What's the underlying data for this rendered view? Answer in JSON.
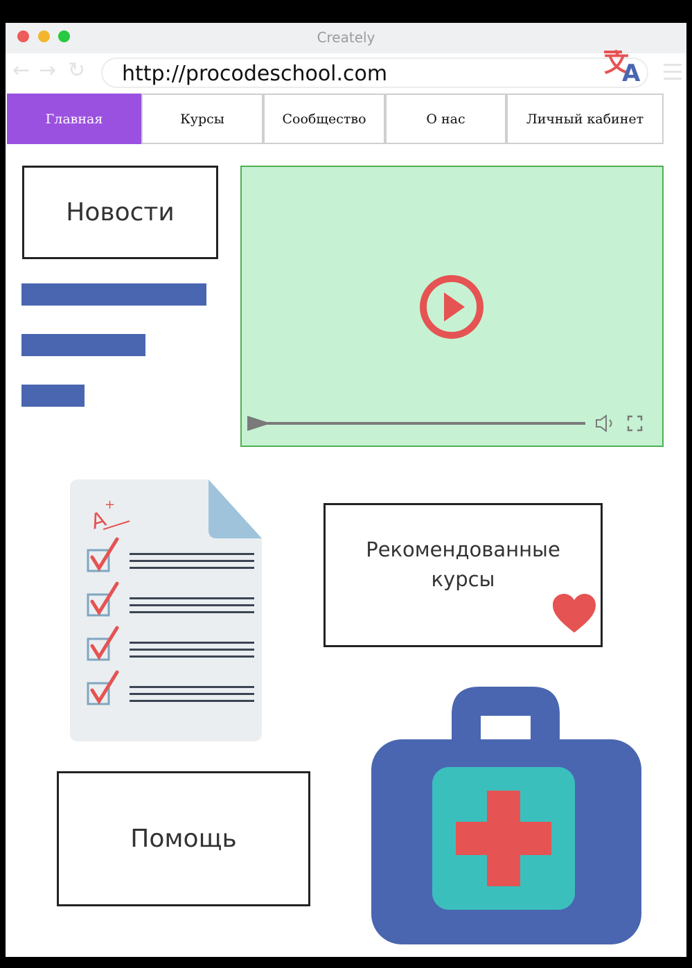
{
  "window": {
    "title": "Creately",
    "url": "http://procodeschool.com"
  },
  "nav": {
    "tabs": [
      {
        "label": "Главная",
        "active": true
      },
      {
        "label": "Курсы",
        "active": false
      },
      {
        "label": "Сообщество",
        "active": false
      },
      {
        "label": "О нас",
        "active": false
      },
      {
        "label": "Личный кабинет",
        "active": false
      }
    ]
  },
  "news": {
    "title": "Новости"
  },
  "video": {
    "play_icon": "play-circle-icon",
    "volume_icon": "volume-icon",
    "fullscreen_icon": "fullscreen-icon"
  },
  "recommended": {
    "line1": "Рекомендованные",
    "line2": "курсы",
    "icon": "heart-icon"
  },
  "help": {
    "title": "Помощь"
  },
  "icons": {
    "document": "checklist-document-icon",
    "medkit": "first-aid-kit-icon",
    "translate": "translate-icon"
  },
  "colors": {
    "active_tab": "#9b51e0",
    "bars": "#4a66b0",
    "video_bg": "#c6f2d3",
    "accent_red": "#e55353",
    "kit_blue": "#4a66b0",
    "kit_teal": "#3bbfbd"
  }
}
